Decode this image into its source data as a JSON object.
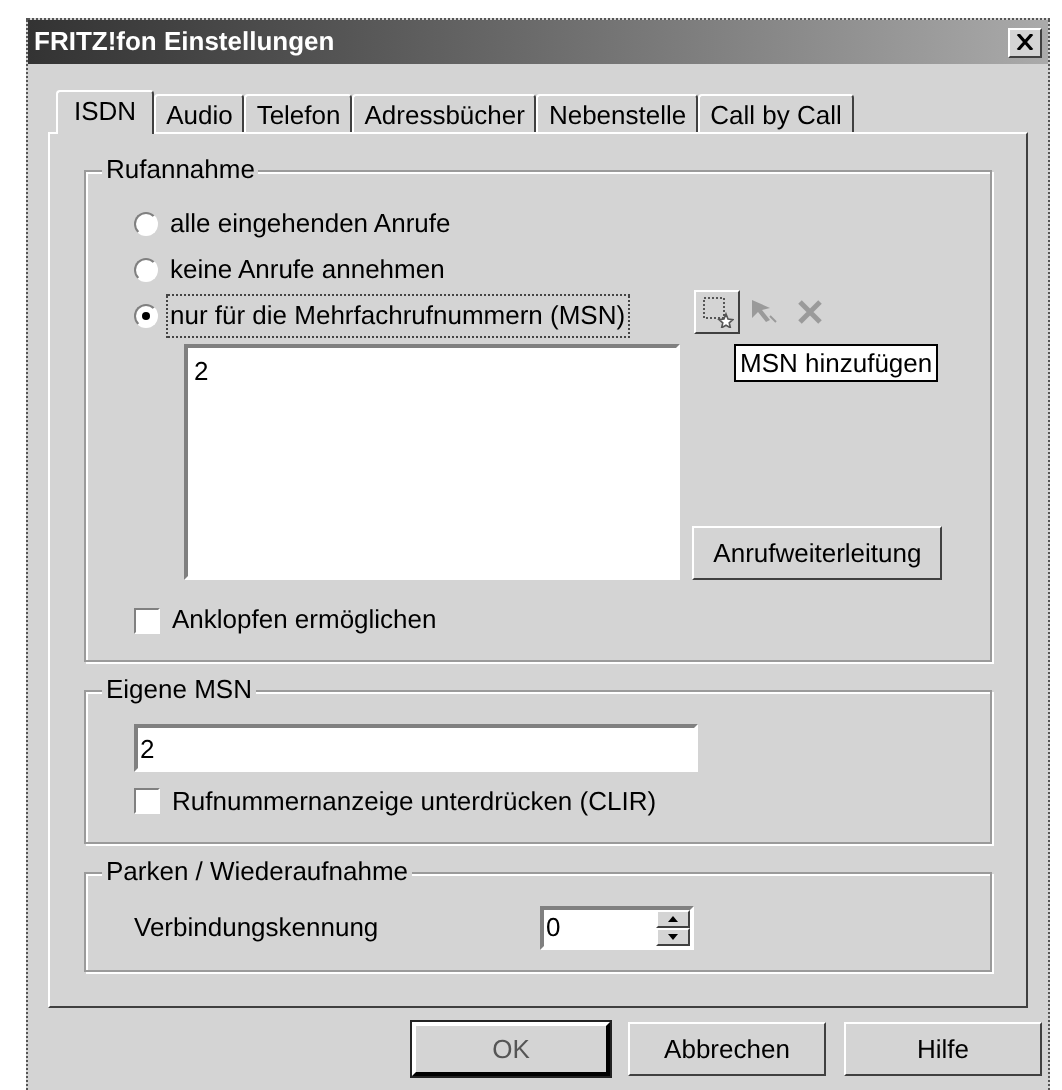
{
  "window": {
    "title": "FRITZ!fon Einstellungen"
  },
  "tabs": [
    {
      "label": "ISDN",
      "selected": true
    },
    {
      "label": "Audio",
      "selected": false
    },
    {
      "label": "Telefon",
      "selected": false
    },
    {
      "label": "Adressbücher",
      "selected": false
    },
    {
      "label": "Nebenstelle",
      "selected": false
    },
    {
      "label": "Call by Call",
      "selected": false
    }
  ],
  "rufannahme": {
    "label": "Rufannahme",
    "options": [
      {
        "label": "alle eingehenden Anrufe",
        "selected": false,
        "focused": false
      },
      {
        "label": "keine Anrufe annehmen",
        "selected": false,
        "focused": false
      },
      {
        "label": "nur für die Mehrfachrufnummern (MSN)",
        "selected": true,
        "focused": true
      }
    ],
    "toolbar": [
      {
        "kind": "add",
        "disabled": false
      },
      {
        "kind": "edit",
        "disabled": true
      },
      {
        "kind": "delete",
        "disabled": true
      }
    ],
    "tooltip": "MSN hinzufügen",
    "msn_list": [
      "2"
    ],
    "forward_button": "Anrufweiterleitung",
    "knocking": {
      "label": "Anklopfen ermöglichen",
      "checked": false
    }
  },
  "eigene_msn": {
    "label": "Eigene MSN",
    "value": "2",
    "clir": {
      "label": "Rufnummernanzeige unterdrücken (CLIR)",
      "checked": false
    }
  },
  "parken": {
    "label": "Parken / Wiederaufnahme",
    "field_label": "Verbindungskennung",
    "value": "0"
  },
  "buttons": [
    {
      "label": "OK",
      "default": true
    },
    {
      "label": "Abbrechen",
      "default": false
    },
    {
      "label": "Hilfe",
      "default": false
    }
  ]
}
